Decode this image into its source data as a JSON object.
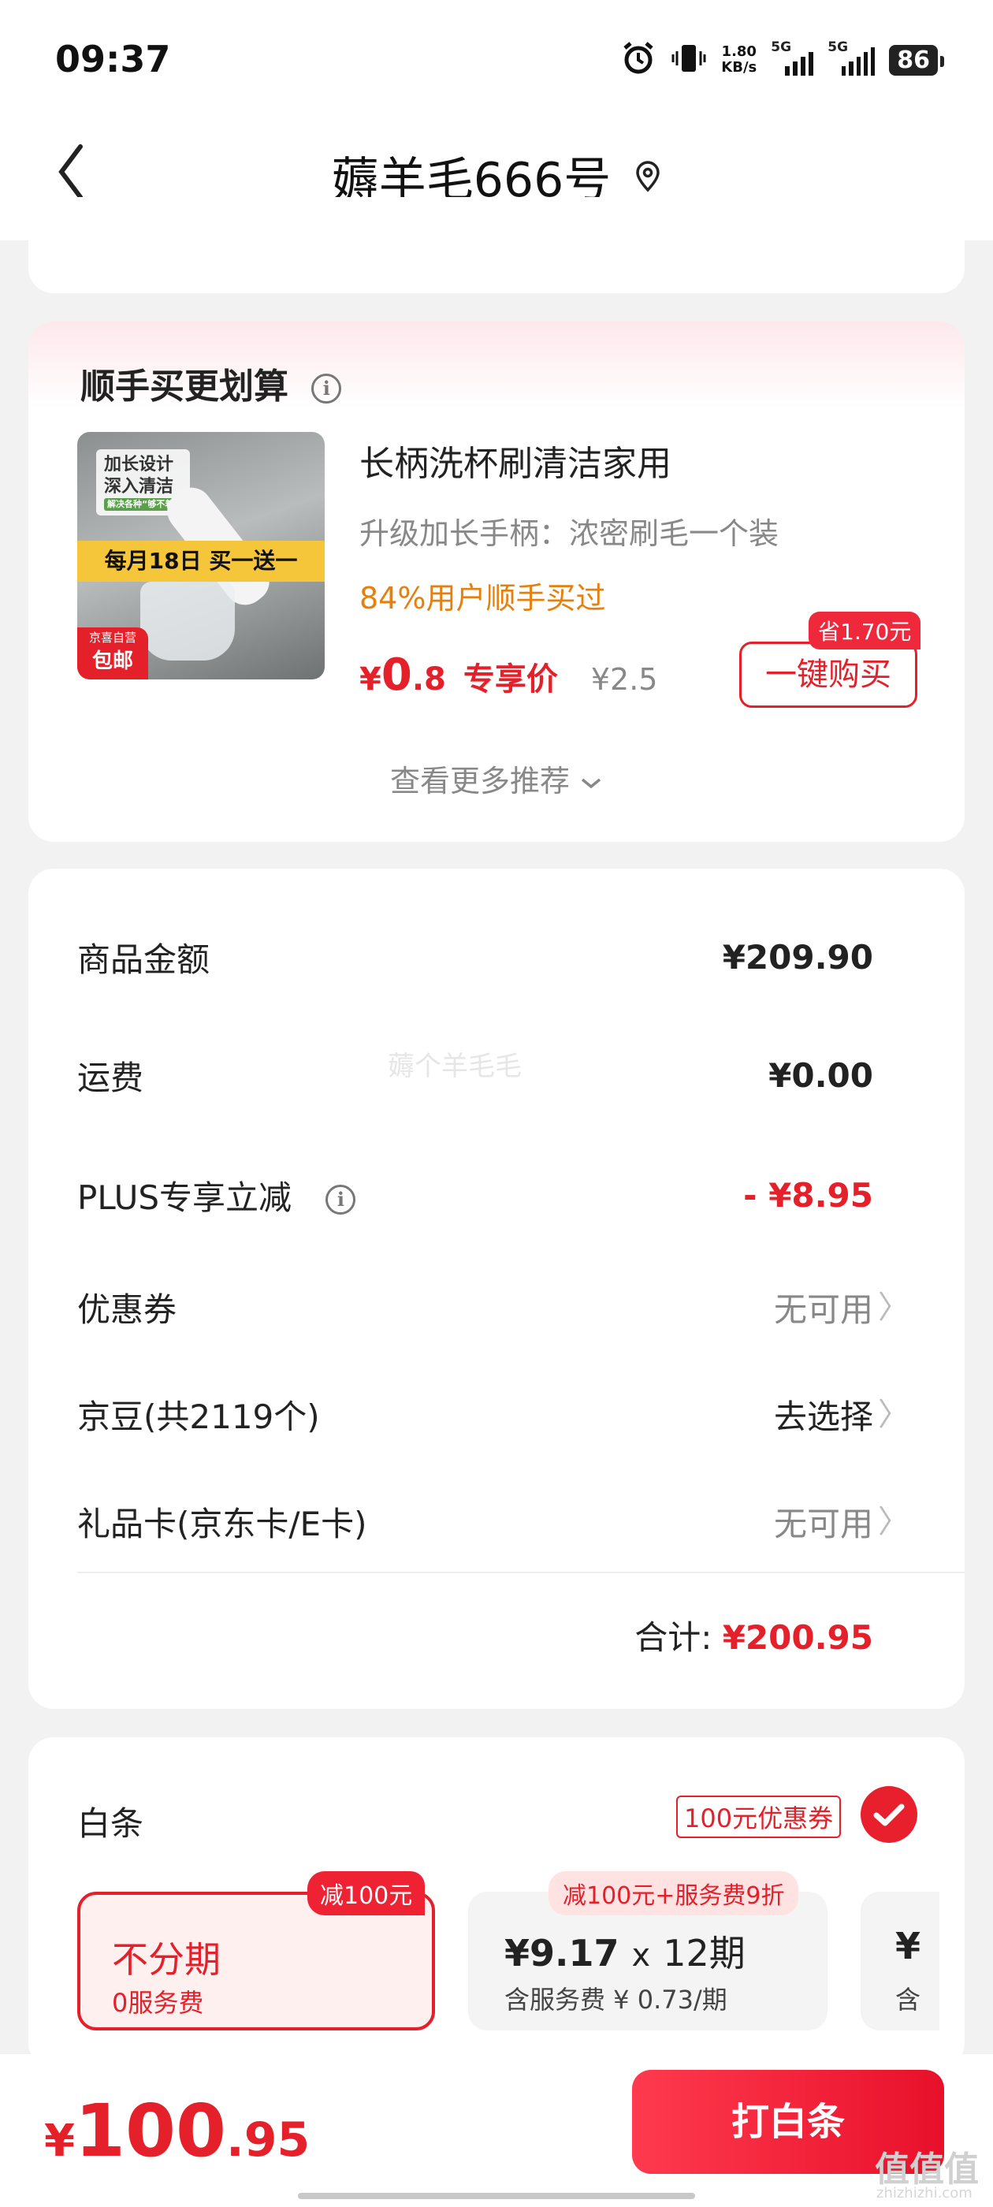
{
  "status": {
    "time": "09:37",
    "speed_value": "1.80",
    "speed_unit": "KB/s",
    "net1": "5G",
    "net2": "5G",
    "battery": "86"
  },
  "header": {
    "title": "薅羊毛666号"
  },
  "recommend": {
    "section_title": "顺手买更划算",
    "product": {
      "image_text_1": "加长设计",
      "image_text_2": "深入清洁",
      "image_text_3": "解决各种“够不着”",
      "image_banner": "每月18日 买一送一",
      "image_tag_1": "京喜自营",
      "image_tag_2": "包邮",
      "name": "长柄洗杯刷清洁家用",
      "subtitle": "升级加长手柄：浓密刷毛一个装",
      "buy_rate": "84%用户顺手买过",
      "currency": "¥",
      "price_int": "0",
      "price_dec": ".8",
      "price_tag": "专享价",
      "original_price": "¥2.5",
      "save_badge": "省1.70元",
      "buy_button": "一键购买"
    },
    "more_label": "查看更多推荐"
  },
  "summary": {
    "watermark": "薅个羊毛毛",
    "rows": [
      {
        "label": "商品金额",
        "value": "¥209.90"
      },
      {
        "label": "运费",
        "value": "¥0.00"
      },
      {
        "label": "PLUS专享立减",
        "value": "- ¥8.95"
      },
      {
        "label": "优惠券",
        "value": "无可用"
      },
      {
        "label": "京豆(共2119个)",
        "value": "去选择"
      },
      {
        "label": "礼品卡(京东卡/E卡)",
        "value": "无可用"
      }
    ],
    "total_label": "合计:",
    "total_value": "¥200.95"
  },
  "baitiao": {
    "title": "白条",
    "coupon_tag": "100元优惠券",
    "options": [
      {
        "badge": "减100元",
        "title": "不分期",
        "sub": "0服务费"
      },
      {
        "badge": "减100元+服务费9折",
        "title_amount": "¥9.17",
        "title_x": "x",
        "title_period": "12期",
        "sub": "含服务费 ¥ 0.73/期"
      },
      {
        "title": "¥",
        "sub": "含"
      }
    ]
  },
  "bottom": {
    "currency": "¥",
    "total_int": "100",
    "total_dec": ".95",
    "pay_button": "打白条",
    "site_mark": "值值值",
    "site_url": "zhizhizhi.com"
  },
  "colors": {
    "accent_red": "#e4202a",
    "orange": "#e5800f",
    "background": "#f2f2f2"
  }
}
